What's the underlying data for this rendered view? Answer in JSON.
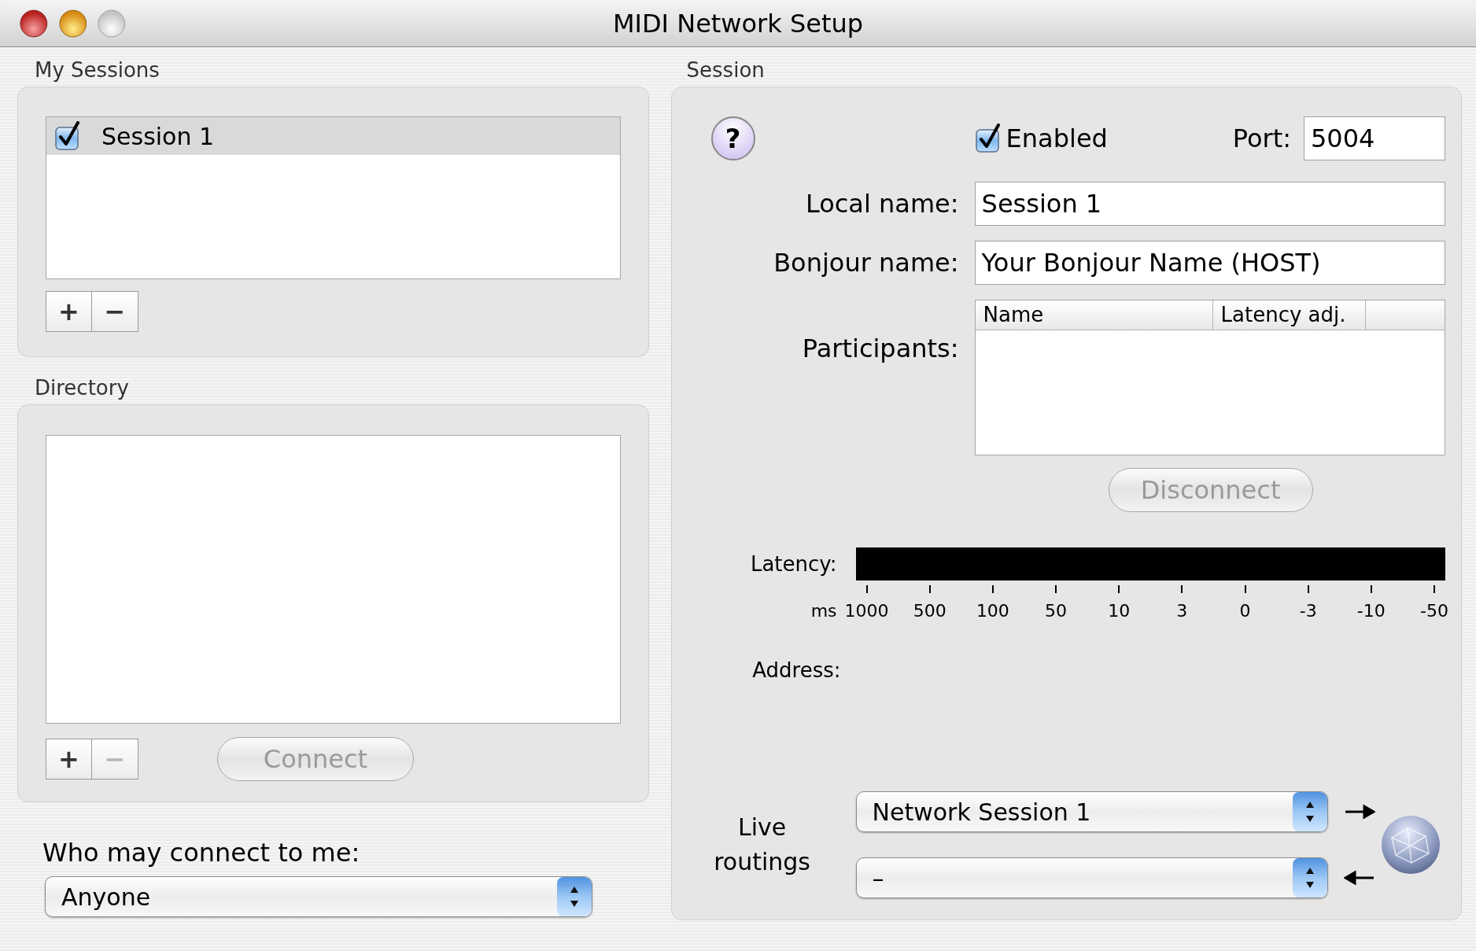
{
  "window": {
    "title": "MIDI Network Setup"
  },
  "my_sessions": {
    "title": "My Sessions",
    "sessions": [
      {
        "name": "Session 1",
        "enabled": true,
        "selected": true
      }
    ],
    "buttons": [
      {
        "label": "+",
        "disabled": false
      },
      {
        "label": "−",
        "disabled": false
      }
    ]
  },
  "directory": {
    "title": "Directory",
    "buttons": [
      {
        "label": "+",
        "disabled": false
      },
      {
        "label": "−",
        "disabled": true
      }
    ],
    "connect": {
      "label": "Connect",
      "disabled": true
    }
  },
  "who_may_connect": {
    "label": "Who may connect to me:",
    "value": "Anyone"
  },
  "session": {
    "title": "Session",
    "help": "?",
    "enabled": {
      "label": "Enabled",
      "checked": true
    },
    "port": {
      "label": "Port:",
      "value": "5004"
    },
    "local_name": {
      "label": "Local name:",
      "value": "Session 1"
    },
    "bonjour_name": {
      "label": "Bonjour name:",
      "value": "Your Bonjour Name (HOST)"
    },
    "participants": {
      "label": "Participants:",
      "columns": [
        "Name",
        "Latency adj."
      ]
    },
    "disconnect": {
      "label": "Disconnect",
      "disabled": true
    },
    "latency": {
      "label": "Latency:",
      "unit": "ms",
      "ticks": [
        "1000",
        "500",
        "100",
        "50",
        "10",
        "3",
        "0",
        "-3",
        "-10",
        "-50"
      ]
    },
    "address": {
      "label": "Address:"
    },
    "live_routings": {
      "label": "Live routings",
      "routes": [
        {
          "value": "Network Session 1",
          "kind": "outgoing"
        },
        {
          "value": "–",
          "kind": "incoming"
        }
      ]
    }
  }
}
